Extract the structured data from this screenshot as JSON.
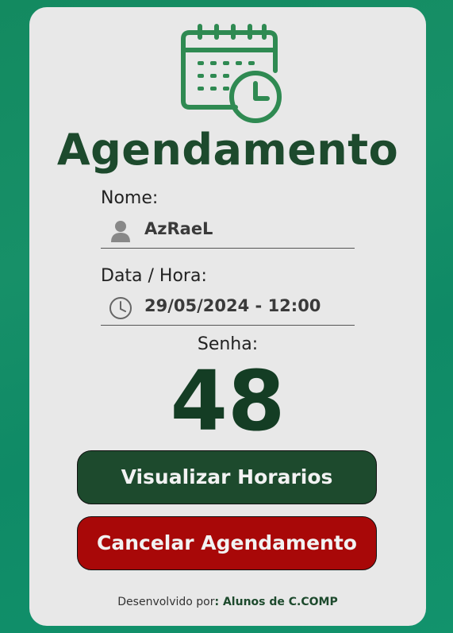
{
  "header": {
    "title": "Agendamento",
    "icon": "calendar-clock-icon"
  },
  "fields": {
    "nome": {
      "label": "Nome:",
      "value": "AzRaeL",
      "icon": "user-icon"
    },
    "data_hora": {
      "label": "Data / Hora:",
      "value": "29/05/2024 - 12:00",
      "icon": "clock-icon"
    }
  },
  "senha": {
    "label": "Senha:",
    "value": "48"
  },
  "buttons": {
    "visualizar": "Visualizar Horarios",
    "cancelar": "Cancelar Agendamento"
  },
  "footer": {
    "prefix": "Desenvolvido por",
    "colon": ":",
    "author": " Alunos de C.COMP"
  },
  "colors": {
    "background": "#138a60",
    "card": "#e8e8e8",
    "primary_dark_green": "#1d4a2d",
    "icon_green": "#2f8a52",
    "cancel_red": "#a80808"
  }
}
